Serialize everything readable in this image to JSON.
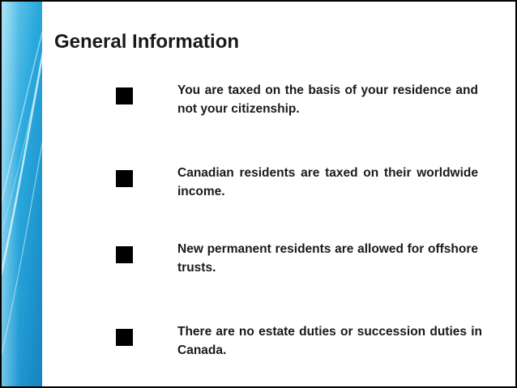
{
  "slide": {
    "title": "General Information",
    "accent_colors": {
      "band_light": "#7fd3f0",
      "band_mid": "#2aa9dd",
      "band_dark": "#1583c2",
      "stroke": "#d8f3fb"
    },
    "bullets": [
      {
        "text": "You are taxed on the basis of your residence and not your citizenship."
      },
      {
        "text": "Canadian residents are taxed on their worldwide income."
      },
      {
        "text": "New permanent residents are allowed for offshore trusts."
      },
      {
        "text": "There are no estate duties or succession duties in Canada."
      }
    ]
  }
}
